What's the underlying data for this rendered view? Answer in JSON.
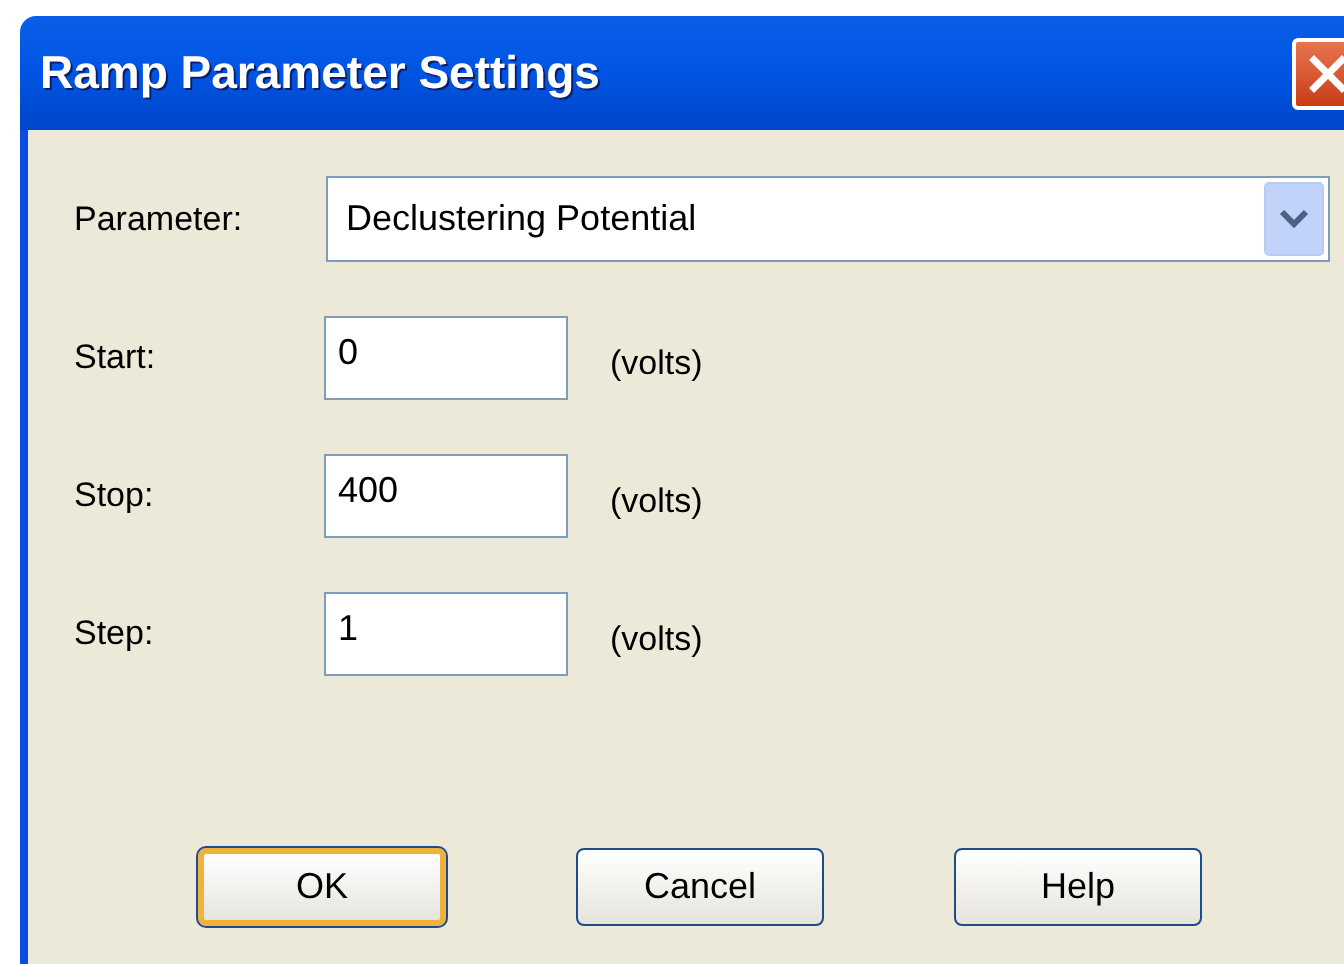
{
  "window": {
    "title": "Ramp Parameter Settings"
  },
  "parameter": {
    "label": "Parameter:",
    "value": "Declustering Potential"
  },
  "fields": [
    {
      "label": "Start:",
      "value": "0",
      "unit": "(volts)"
    },
    {
      "label": "Stop:",
      "value": "400",
      "unit": "(volts)"
    },
    {
      "label": "Step:",
      "value": "1",
      "unit": "(volts)"
    }
  ],
  "buttons": [
    {
      "label": "OK",
      "default": true
    },
    {
      "label": "Cancel",
      "default": false
    },
    {
      "label": "Help",
      "default": false
    }
  ]
}
